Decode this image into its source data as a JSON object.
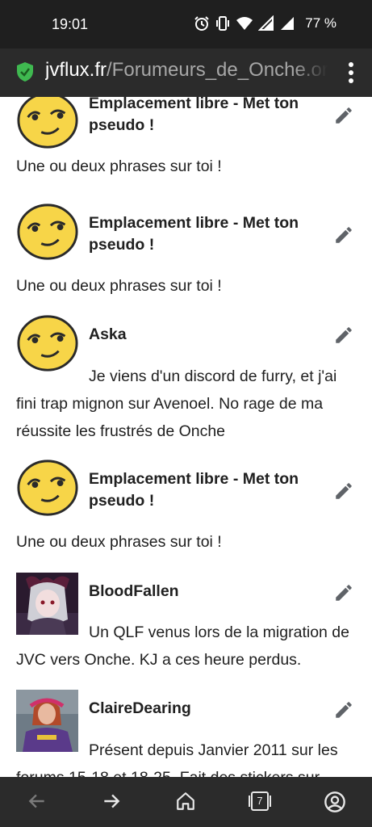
{
  "status_bar": {
    "time": "19:01",
    "battery": "77 %",
    "icons": [
      "alarm-icon",
      "vibrate-icon",
      "wifi-icon",
      "signal-icon",
      "signal-icon-2"
    ]
  },
  "browser": {
    "url_host": "jvflux.fr",
    "url_path": "/Forumeurs_de_Onche.or",
    "tab_count": "7"
  },
  "colors": {
    "status_bg": "#1f1f1f",
    "toolbar_bg": "#2b2b2b",
    "secure_green": "#3fb950",
    "smiley_yellow": "#f7d548",
    "text": "#202020",
    "icon_grey": "#5f6368"
  },
  "entries": [
    {
      "name": "Emplacement libre - Met ton pseudo !",
      "description": "Une ou deux phrases sur toi !",
      "avatar": "smiley-icon"
    },
    {
      "name": "Emplacement libre - Met ton pseudo !",
      "description": "Une ou deux phrases sur toi !",
      "avatar": "smiley-icon"
    },
    {
      "name": "Aska",
      "description": "Je viens d'un discord de furry, et j'ai fini trap mignon sur Avenoel. No rage de ma réussite les frustrés de Onche",
      "avatar": "smiley-icon"
    },
    {
      "name": "Emplacement libre - Met ton pseudo !",
      "description": "Une ou deux phrases sur toi !",
      "avatar": "smiley-icon"
    },
    {
      "name": "BloodFallen",
      "description": "Un QLF venus lors de la migration de JVC vers Onche. KJ a ces heure perdus.",
      "avatar": "anime-avatar"
    },
    {
      "name": "ClaireDearing",
      "description": "Présent depuis Janvier 2011 sur les forums 15-18 et 18-25. Fait des stickers sur",
      "avatar": "photo-avatar"
    }
  ]
}
